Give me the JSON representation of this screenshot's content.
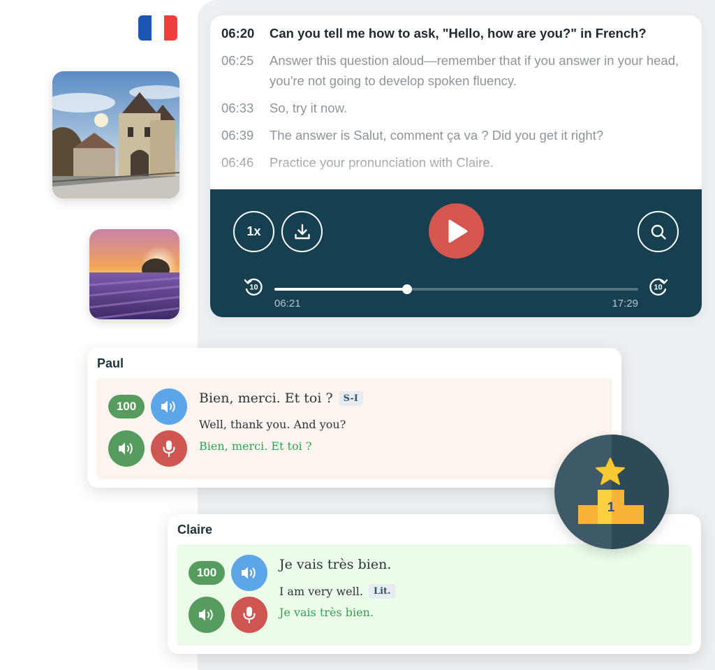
{
  "lesson": {
    "flag_colors": [
      "#1d55b3",
      "#ffffff",
      "#ef3e3e"
    ],
    "photos": [
      {
        "name": "castle-photo"
      },
      {
        "name": "lavender-field-photo"
      }
    ]
  },
  "transcript": {
    "lines": [
      {
        "time": "06:20",
        "text": "Can you tell me how to ask, \"Hello, how are you?\" in French?",
        "active": true
      },
      {
        "time": "06:25",
        "text": "Answer this question aloud—remember that if you answer in your head, you're not going to develop spoken fluency.",
        "active": false
      },
      {
        "time": "06:33",
        "text": "So, try it now.",
        "active": false
      },
      {
        "time": "06:39",
        "text": "The answer is Salut, comment ça va ? Did you get it right?",
        "active": false
      },
      {
        "time": "06:46",
        "text": "Practice your pronunciation with Claire.",
        "active": false
      }
    ]
  },
  "player": {
    "speed_label": "1x",
    "download_icon": "download-icon",
    "search_icon": "search-icon",
    "play_icon": "play-icon",
    "skip_back_label": "10",
    "skip_forward_label": "10",
    "current_time": "06:21",
    "total_time": "17:29",
    "progress": 0.364,
    "colors": {
      "bar": "#16404f",
      "play": "#d4564f"
    }
  },
  "dialogue": [
    {
      "speaker": "Paul",
      "score": "100",
      "phrase": "Bien, merci. Et toi ?",
      "phrase_tag": "S-I",
      "translation": "Well, thank you. And you?",
      "translation_tag": "",
      "attempt": "Bien, merci. Et toi ?"
    },
    {
      "speaker": "Claire",
      "score": "100",
      "phrase": "Je vais très bien.",
      "phrase_tag": "",
      "translation": "I am very well.",
      "translation_tag": "Lit.",
      "attempt": "Je vais très bien."
    }
  ],
  "award": {
    "icon": "podium-star-icon",
    "rank": "1"
  }
}
